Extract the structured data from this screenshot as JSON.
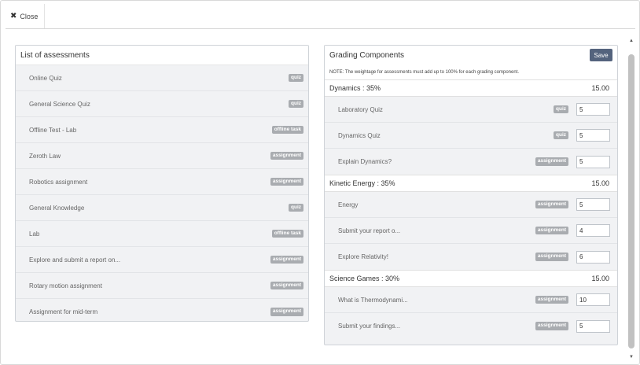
{
  "close_label": "Close",
  "assessments_panel": {
    "title": "List of assessments",
    "items": [
      {
        "name": "Online Quiz",
        "type": "quiz"
      },
      {
        "name": "General Science Quiz",
        "type": "quiz"
      },
      {
        "name": "Offline Test - Lab",
        "type": "offline task"
      },
      {
        "name": "Zeroth Law",
        "type": "assignment"
      },
      {
        "name": "Robotics assignment",
        "type": "assignment"
      },
      {
        "name": "General Knowledge",
        "type": "quiz"
      },
      {
        "name": "Lab",
        "type": "offline task"
      },
      {
        "name": "Explore and submit a report on...",
        "type": "assignment"
      },
      {
        "name": "Rotary motion assignment",
        "type": "assignment"
      },
      {
        "name": "Assignment for mid-term",
        "type": "assignment"
      }
    ]
  },
  "grading_panel": {
    "title": "Grading Components",
    "save_label": "Save",
    "note": "NOTE: The weightage for assessments must add up to 100% for each grading component.",
    "components": [
      {
        "label": "Dynamics : 35%",
        "total": "15.00",
        "items": [
          {
            "name": "Laboratory Quiz",
            "type": "quiz",
            "weight": "5"
          },
          {
            "name": "Dynamics Quiz",
            "type": "quiz",
            "weight": "5"
          },
          {
            "name": "Explain Dynamics?",
            "type": "assignment",
            "weight": "5"
          }
        ]
      },
      {
        "label": "Kinetic Energy : 35%",
        "total": "15.00",
        "items": [
          {
            "name": "Energy",
            "type": "assignment",
            "weight": "5"
          },
          {
            "name": "Submit your report o...",
            "type": "assignment",
            "weight": "4"
          },
          {
            "name": "Explore Relativity!",
            "type": "assignment",
            "weight": "6"
          }
        ]
      },
      {
        "label": "Science Games : 30%",
        "total": "15.00",
        "items": [
          {
            "name": "What is Thermodynami...",
            "type": "assignment",
            "weight": "10"
          },
          {
            "name": "Submit your findings...",
            "type": "assignment",
            "weight": "5"
          }
        ]
      }
    ]
  }
}
